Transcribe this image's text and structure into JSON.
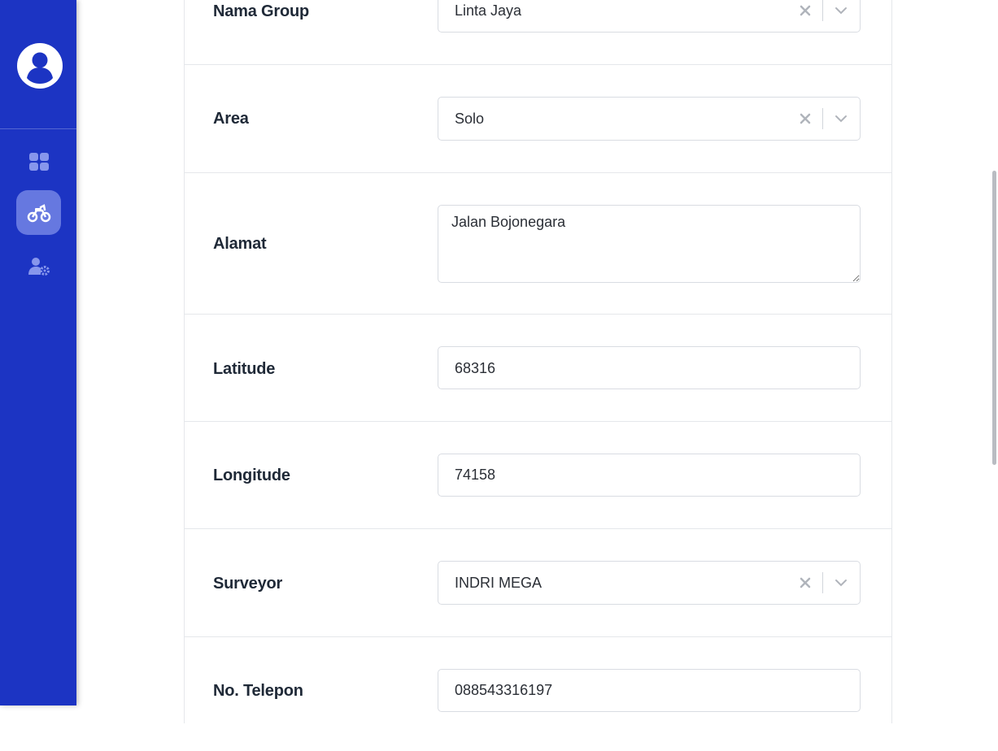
{
  "sidebar": {
    "avatar_icon": "user-circle-icon",
    "items": [
      {
        "id": "dashboard",
        "icon": "dashboard-grid-icon",
        "active": false
      },
      {
        "id": "motor",
        "icon": "motorcycle-icon",
        "active": true
      },
      {
        "id": "user-settings",
        "icon": "user-cog-icon",
        "active": false
      }
    ],
    "colors": {
      "background": "#1c34c3",
      "active": "#6678e0",
      "icon": "#8796ec"
    }
  },
  "form": {
    "nama_group": {
      "label": "Nama Group",
      "value": "Linta Jaya"
    },
    "area": {
      "label": "Area",
      "value": "Solo"
    },
    "alamat": {
      "label": "Alamat",
      "value": "Jalan Bojonegara"
    },
    "latitude": {
      "label": "Latitude",
      "value": "68316"
    },
    "longitude": {
      "label": "Longitude",
      "value": "74158"
    },
    "surveyor": {
      "label": "Surveyor",
      "value": "INDRI MEGA"
    },
    "no_telepon": {
      "label": "No. Telepon",
      "value": "088543316197"
    }
  }
}
